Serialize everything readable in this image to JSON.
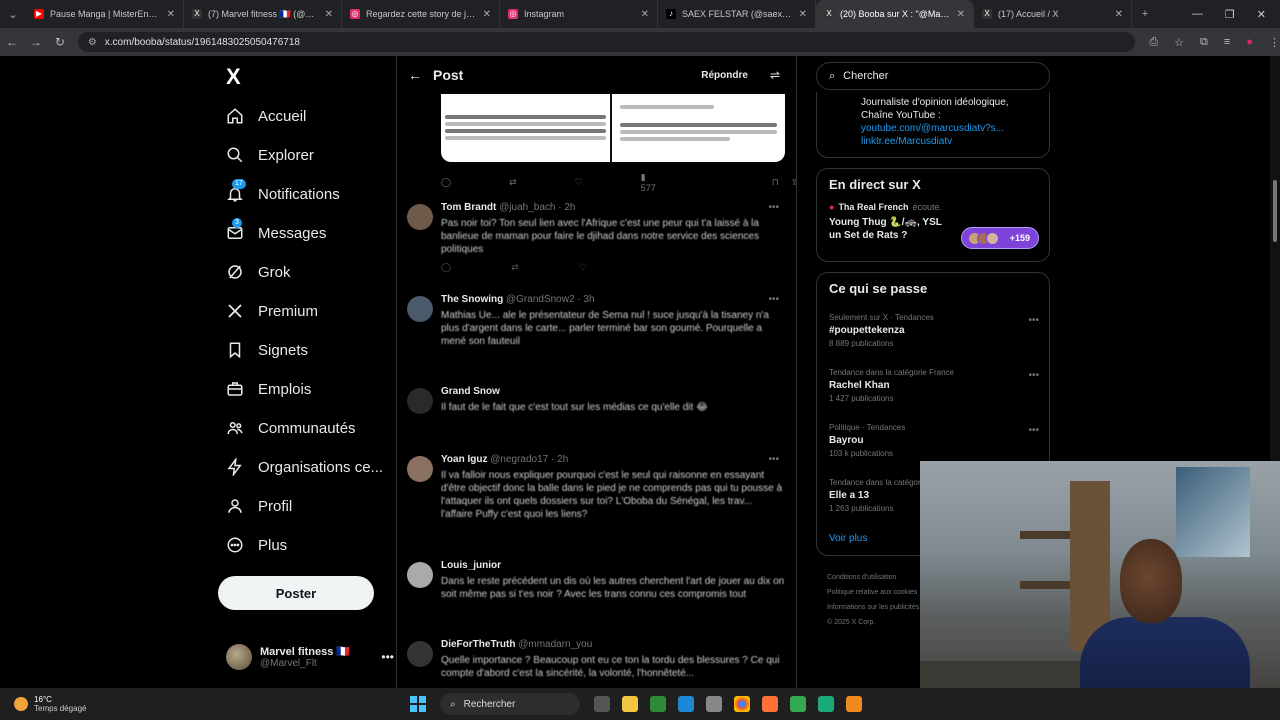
{
  "browser": {
    "tabs": [
      {
        "title": "Pause Manga | MisterEnzor - Yo",
        "color": "#ff0000"
      },
      {
        "title": "(7) Marvel fitness 🇫🇷 (@Marvel_",
        "color": "#333333"
      },
      {
        "title": "Regardez cette story de john cr",
        "color": "#e1306c"
      },
      {
        "title": "Instagram",
        "color": "#e1306c"
      },
      {
        "title": "SAEX FELSTAR (@saexfelstar) |",
        "color": "#000000"
      },
      {
        "title": "(20) Booba sur X : \"@MarcusD",
        "color": "#333333"
      },
      {
        "title": "(17) Accueil / X",
        "color": "#333333"
      }
    ],
    "url": "x.com/booba/status/1961483025050476718"
  },
  "nav": {
    "logo": "X",
    "items": [
      {
        "label": "Accueil",
        "icon": "home-icon"
      },
      {
        "label": "Explorer",
        "icon": "search-icon"
      },
      {
        "label": "Notifications",
        "icon": "bell-icon",
        "badge": "17"
      },
      {
        "label": "Messages",
        "icon": "mail-icon",
        "badge": "3"
      },
      {
        "label": "Grok",
        "icon": "grok-icon"
      },
      {
        "label": "Premium",
        "icon": "x-icon"
      },
      {
        "label": "Signets",
        "icon": "bookmark-icon"
      },
      {
        "label": "Emplois",
        "icon": "briefcase-icon"
      },
      {
        "label": "Communautés",
        "icon": "people-icon"
      },
      {
        "label": "Organisations ce...",
        "icon": "lightning-icon"
      },
      {
        "label": "Profil",
        "icon": "user-icon"
      },
      {
        "label": "Plus",
        "icon": "more-circle-icon"
      }
    ],
    "post_button": "Poster",
    "account": {
      "name": "Marvel fitness 🇫🇷",
      "handle": "@Marvel_Flt"
    }
  },
  "center": {
    "title": "Post",
    "reply_button": "Répondre",
    "actions": {
      "views": "577"
    },
    "replies": [
      {
        "name": "Tom Brandt",
        "handle": "@juah_bach · 2h",
        "text": "Pas noir toi? Ton seul lien avec l'Afrique c'est une peur qui t'a laissé à la banlieue de maman pour faire le djihad dans notre service des sciences politiques",
        "avatar": "#6e5a4a"
      },
      {
        "name": "The Snowing",
        "handle": "@GrandSnow2 · 3h",
        "text": "Mathias Ue... ale le présentateur de Sema nul ! suce jusqu'à la tisaney n'a plus d'argent dans le carte... parler terminé bar son goumé. Pourquelle a mené son fauteuil",
        "avatar": "#4a5a6a"
      },
      {
        "name": "Grand Snow",
        "handle": "",
        "text": "Il faut de le fait que c'est tout sur les médias ce qu'elle dit 😂",
        "avatar": "#2a2a2a"
      },
      {
        "name": "Yoan Iguz",
        "handle": "@negrado17 · 2h",
        "text": "Il va falloir nous expliquer pourquoi c'est le seul qui raisonne en essayant d'être objectif donc la balle dans le pied je ne comprends pas qui tu pousse à l'attaquer ils ont quels dossiers sur toi? L'Oboba du Sénégal, les trav... l'affaire Puffy c'est quoi les liens?",
        "avatar": "#8a7060"
      },
      {
        "name": "Louis_junior",
        "handle": "",
        "text": "Dans le reste précédent un dis où les autres cherchent l'art de jouer au dix on soit même pas si t'es noir ? Avec les trans connu ces compromis tout",
        "avatar": "#aaaaaa"
      },
      {
        "name": "DieForTheTruth",
        "handle": "@mmadarn_you",
        "text": "Quelle importance ? Beaucoup ont eu ce ton la tordu des blessures ? Ce qui compte d'abord c'est la sincérité, la volonté, l'honnêteté...",
        "avatar": "#333333"
      }
    ]
  },
  "right": {
    "search_placeholder": "Chercher",
    "bio": {
      "line1": "Journaliste d'opinion idéologique,",
      "line2": "Chaîne YouTube :",
      "link1": "youtube.com/@marcusdiatv?s...",
      "link2": "linktr.ee/Marcusdiatv"
    },
    "live": {
      "title": "En direct sur X",
      "host": "Tha Real French",
      "host_suffix": "écoute.",
      "space_title": "Young Thug 🐍/🚓, YSL un Set de Rats ?",
      "listeners": "+159"
    },
    "trends_title": "Ce qui se passe",
    "trends": [
      {
        "meta": "Seulement sur X · Tendances",
        "name": "#poupettekenza",
        "count": "8 889 publications"
      },
      {
        "meta": "Tendance dans la catégorie France",
        "name": "Rachel Khan",
        "count": "1 427 publications"
      },
      {
        "meta": "Politique · Tendances",
        "name": "Bayrou",
        "count": "103 k publications"
      },
      {
        "meta": "Tendance dans la catégorie France",
        "name": "Elle a 13",
        "count": "1 263 publications"
      }
    ],
    "see_more": "Voir plus",
    "footer": [
      "Conditions d'utilisation",
      "Politique relative aux cookies",
      "Informations sur les publicités",
      "© 2025 X Corp."
    ]
  },
  "taskbar": {
    "temp": "16°C",
    "weather": "Temps dégagé",
    "search": "Rechercher"
  }
}
